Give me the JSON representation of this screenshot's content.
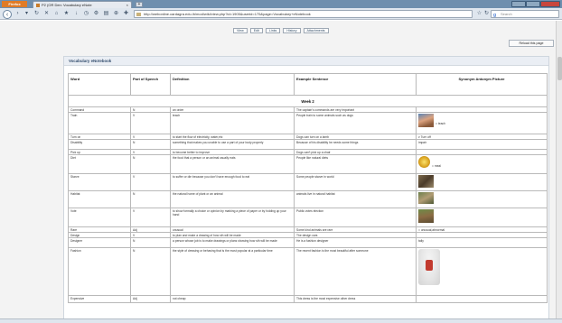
{
  "browser": {
    "app_button": "Firefox",
    "tab_title": "P2 (OR Den: Vocabulary eNote",
    "url": "http://webonline.cardagra.edu.ih/mod/wiki/view.php?id=1905&userid=175&page=Vocabulary+eNotebook",
    "search_placeholder": "Search"
  },
  "page_tabs": [
    "View",
    "Edit",
    "Links",
    "History",
    "Attachments"
  ],
  "reload_label": "Reload this page",
  "panel_title": "Vocabulary eNotebook",
  "table": {
    "headers": [
      "Word",
      "Part of Speech",
      "Definition",
      "Example Sentence",
      "Synonym Antonym Picture"
    ],
    "week_label": "Week 2",
    "rows": [
      {
        "word": "Command",
        "pos": "N",
        "def": "an order",
        "ex": "The captain's commands are very important",
        "syn": ""
      },
      {
        "word": "Train",
        "pos": "V",
        "def": "teach",
        "ex": "People train to some animals such as dogs",
        "syn": "= teach"
      },
      {
        "word": "Turn on",
        "pos": "V",
        "def": "to start the flow of electricity, water,etc",
        "ex": "Dogs can turn on a lamb",
        "syn": "≠ Turn off"
      },
      {
        "word": "Disability",
        "pos": "N",
        "def": "something that makes you unable to use a part of your body properly",
        "ex": "Because of his disability he needs some things",
        "syn": "impair"
      },
      {
        "word": "Pick up",
        "pos": "V",
        "def": "to become better to improve",
        "ex": "Dogs can't pick up a chair",
        "syn": ""
      },
      {
        "word": "Diet",
        "pos": "N",
        "def": "the food that a person or an animal usually eats",
        "ex": "People like natural diets",
        "syn": "= meal"
      },
      {
        "word": "Starve",
        "pos": "V",
        "def": "to suffer or die because you don't have enough food to eat",
        "ex": "Some people starve in world",
        "syn": ""
      },
      {
        "word": "Habitat",
        "pos": "N",
        "def": "the natural home of plant or an animal",
        "ex": "animals live in natural habitat",
        "syn": ""
      },
      {
        "word": "Vote",
        "pos": "V",
        "def": "to show formally a choice or opinion by marking a piece of paper or by holding up your hand",
        "ex": "Public votes election",
        "syn": ""
      },
      {
        "word": "Rare",
        "pos": "Adj",
        "def": "unusual",
        "ex": "Some kind animals are rare",
        "syn": "= unusual,abnormal"
      },
      {
        "word": "Design",
        "pos": "V",
        "def": "to plan and make a drawing of how sth will be made",
        "ex": "The design cars",
        "syn": ""
      },
      {
        "word": "Designer",
        "pos": "N",
        "def": "a person whose job is to make drawings or plans showing how sth will be made",
        "ex": "He is a fashion designer",
        "syn": "tally"
      },
      {
        "word": "Fashion",
        "pos": "N",
        "def": "the style of dressing or behaving that is the most popular at a particular time",
        "ex": "The recent fashion is the most beautiful after someone",
        "syn": ""
      },
      {
        "word": "Expensive",
        "pos": "Adj",
        "def": "not cheap",
        "ex": "This dress is the most expensive other dress",
        "syn": ""
      }
    ]
  }
}
